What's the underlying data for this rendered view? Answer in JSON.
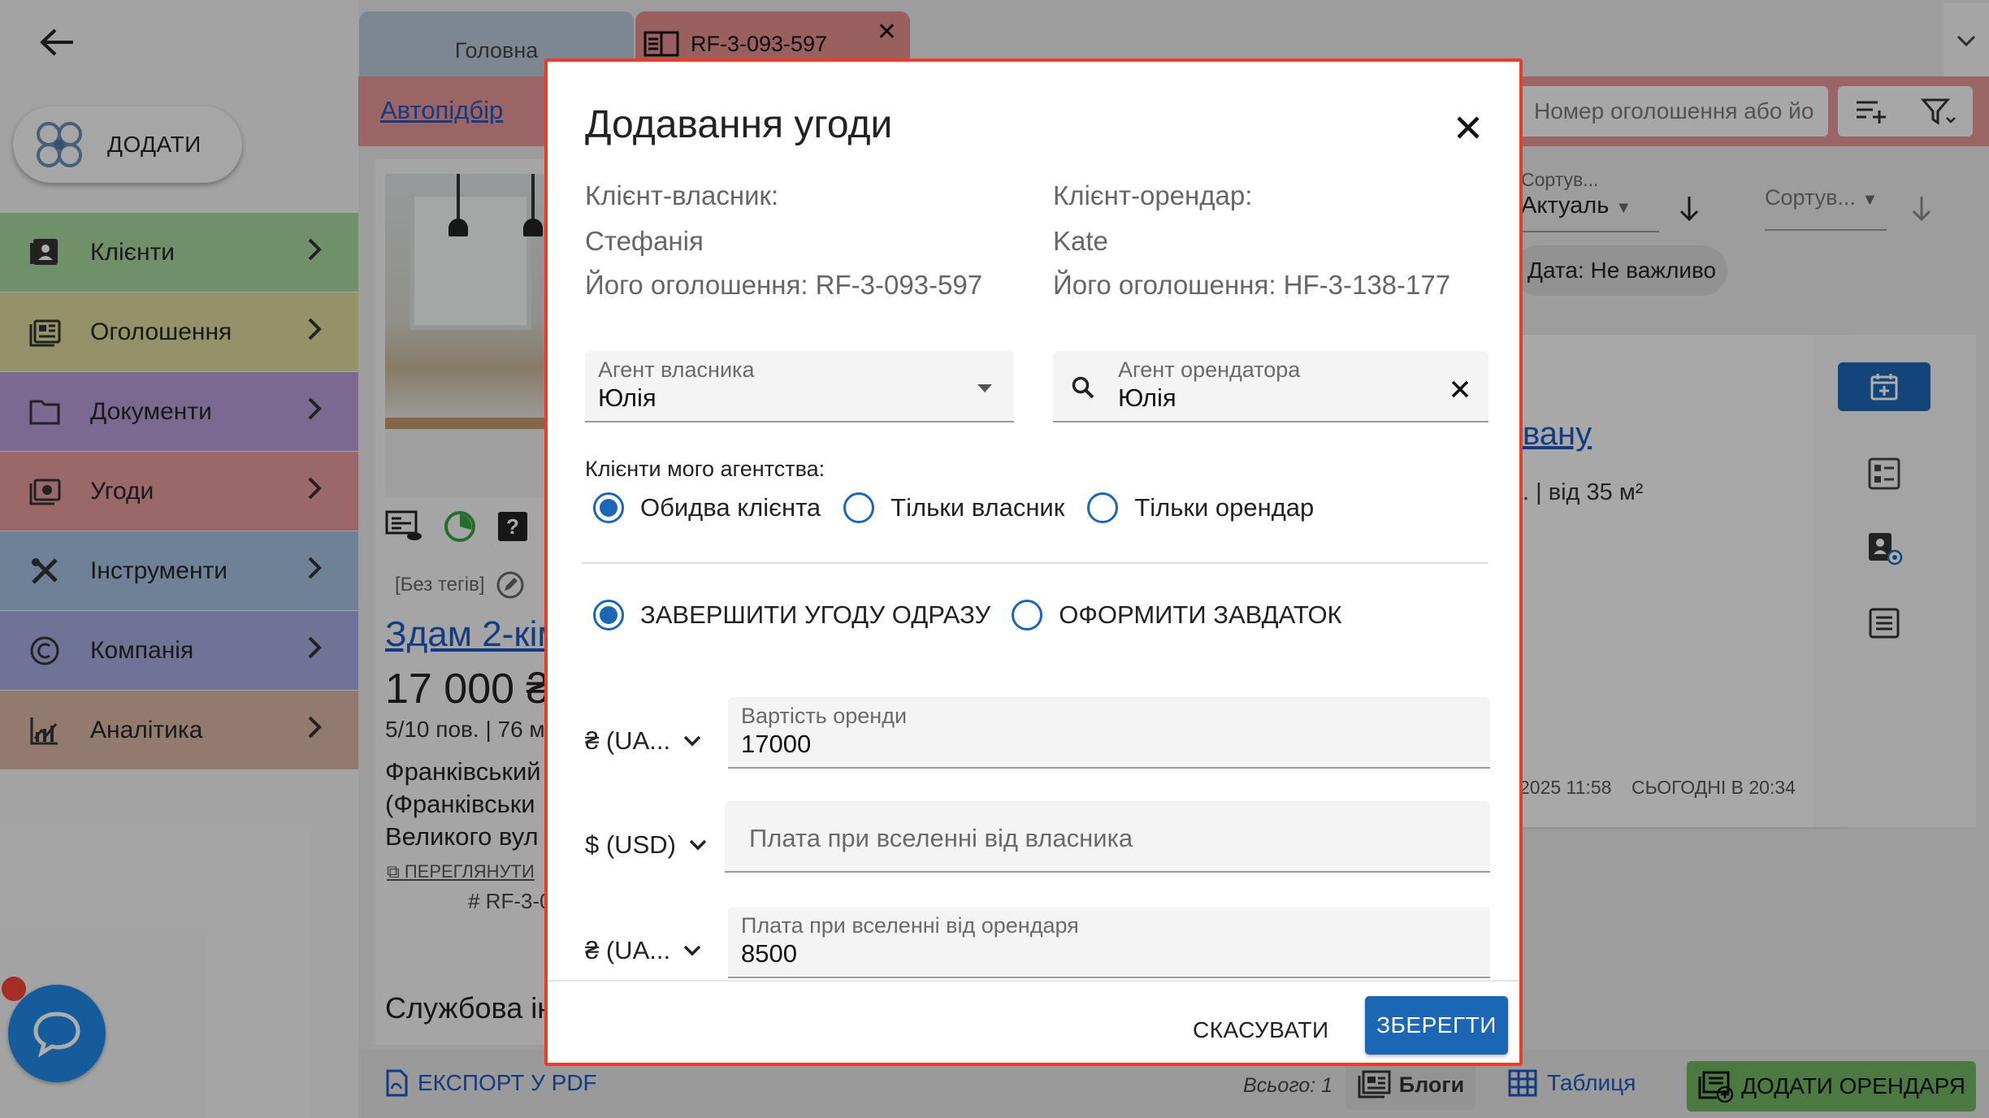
{
  "colors": {
    "accent": "#1c66b6",
    "link": "#1d57c0",
    "dialog_border": "#e83c2e",
    "toolbar": "#e69595",
    "add_tenant": "#71b361"
  },
  "sidebar": {
    "add_label": "ДОДАТИ",
    "items": [
      {
        "label": "Клієнти",
        "icon": "contacts-icon",
        "color": "#a6d49b"
      },
      {
        "label": "Оголошення",
        "icon": "listing-icon",
        "color": "#d9d89a"
      },
      {
        "label": "Документи",
        "icon": "folder-icon",
        "color": "#b79bd6"
      },
      {
        "label": "Угоди",
        "icon": "deal-icon",
        "color": "#e39a9a"
      },
      {
        "label": "Інструменти",
        "icon": "tools-icon",
        "color": "#a4bede"
      },
      {
        "label": "Компанія",
        "icon": "copyright-icon",
        "color": "#a4aadd"
      },
      {
        "label": "Аналітика",
        "icon": "analytics-icon",
        "color": "#d7b6a3"
      }
    ]
  },
  "tabs": [
    {
      "label": "Головна"
    },
    {
      "label": "RF-3-093-597"
    }
  ],
  "toolbar": {
    "autopodbir": "Автопідбір",
    "search_placeholder": "Номер оголошення або йо"
  },
  "listing": {
    "tags": "[Без тегів]",
    "title": "Здам 2-кім",
    "price": "17 000 ₴",
    "meta": "5/10 пов. | 76 м",
    "address_lines": [
      "Франківський",
      "(Франківськи",
      "Великого вул"
    ],
    "view_link": "ПЕРЕГЛЯНУТИ",
    "id": "# RF-3-0",
    "service_heading": "Службова ін"
  },
  "right_panel": {
    "sort1_label": "Сортув...",
    "sort1_value": "Актуаль",
    "sort2_label": "Сортув...",
    "date_chip": "Дата: Не важливо",
    "card_link": "вану",
    "card_meta": ". | від 35 м²",
    "date1": "2025 11:58",
    "date2": "СЬОГОДНІ В 20:34"
  },
  "bottom_bar": {
    "export_pdf": "ЕКСПОРТ У PDF",
    "total": "Всього: 1",
    "blogs": "Блоги",
    "table": "Таблиця",
    "add_tenant": "ДОДАТИ ОРЕНДАРЯ"
  },
  "dialog": {
    "title": "Додавання угоди",
    "owner": {
      "heading": "Клієнт-власник:",
      "name": "Стефанія",
      "listing": "Його оголошення: RF-3-093-597"
    },
    "tenant": {
      "heading": "Клієнт-орендар:",
      "name": "Kate",
      "listing": "Його оголошення: HF-3-138-177"
    },
    "owner_agent": {
      "label": "Агент власника",
      "value": "Юлія"
    },
    "tenant_agent": {
      "label": "Агент орендатора",
      "value": "Юлія"
    },
    "agency_clients_label": "Клієнти мого агентства:",
    "agency_options": [
      {
        "label": "Обидва клієнта",
        "selected": true
      },
      {
        "label": "Тільки власник",
        "selected": false
      },
      {
        "label": "Тільки орендар",
        "selected": false
      }
    ],
    "deal_mode_options": [
      {
        "label": "ЗАВЕРШИТИ УГОДУ ОДРАЗУ",
        "selected": true
      },
      {
        "label": "ОФОРМИТИ ЗАВДАТОК",
        "selected": false
      }
    ],
    "rent": {
      "currency": "₴ (UA...",
      "label": "Вартість оренди",
      "value": "17000"
    },
    "owner_fee": {
      "currency": "$ (USD)",
      "placeholder": "Плата при вселенні від власника",
      "value": ""
    },
    "tenant_fee": {
      "currency": "₴ (UA...",
      "label": "Плата при вселенні від орендаря",
      "value": "8500"
    },
    "cancel": "СКАСУВАТИ",
    "save": "ЗБЕРЕГТИ"
  }
}
